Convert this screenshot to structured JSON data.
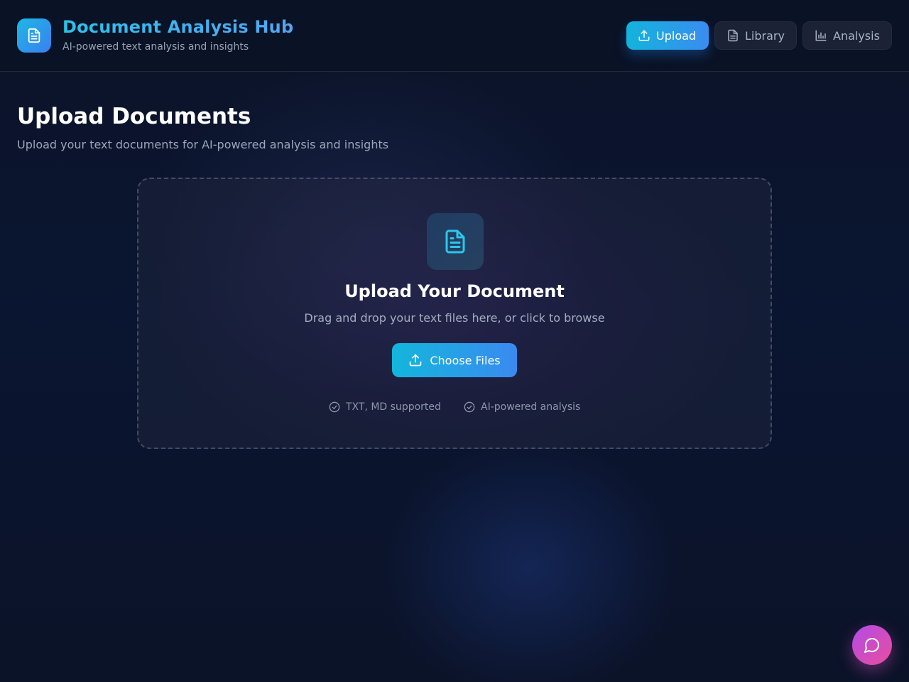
{
  "header": {
    "title": "Document Analysis Hub",
    "subtitle": "AI-powered text analysis and insights",
    "logo_icon": "document-icon"
  },
  "nav": [
    {
      "label": "Upload",
      "icon": "upload-icon",
      "active": true
    },
    {
      "label": "Library",
      "icon": "document-icon",
      "active": false
    },
    {
      "label": "Analysis",
      "icon": "bar-chart-icon",
      "active": false
    }
  ],
  "page": {
    "title": "Upload Documents",
    "subtitle": "Upload your text documents for AI-powered analysis and insights"
  },
  "dropzone": {
    "icon": "document-icon",
    "title": "Upload Your Document",
    "description": "Drag and drop your text files here, or click to browse",
    "button_label": "Choose Files",
    "features": [
      {
        "label": "TXT, MD supported",
        "icon": "check-circle-icon"
      },
      {
        "label": "AI-powered analysis",
        "icon": "check-circle-icon"
      }
    ]
  },
  "chat": {
    "icon": "chat-bubble-icon"
  },
  "colors": {
    "accent_cyan": "#13b6dc",
    "accent_blue": "#3a8af0",
    "chat_purple": "#b34be8",
    "chat_pink": "#e84e9e",
    "background": "#0b1226"
  }
}
